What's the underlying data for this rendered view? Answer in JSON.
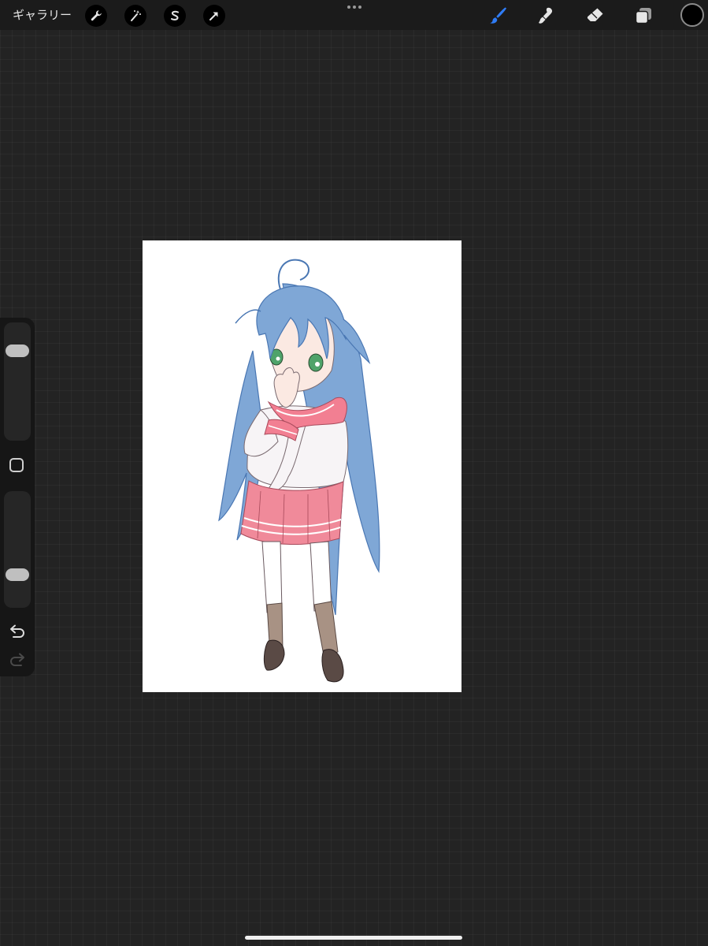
{
  "toolbar": {
    "gallery_label": "ギャラリー",
    "left_tools": [
      "wrench-icon",
      "magic-wand-icon",
      "selection-icon",
      "transform-arrow-icon"
    ],
    "menu_icon": "more-dots-icon",
    "right_tools": [
      "brush-icon",
      "smudge-icon",
      "eraser-icon",
      "layers-icon"
    ],
    "active_tool": "brush",
    "active_color": "#2f7cf6",
    "current_color": "#000000"
  },
  "sidebar": {
    "brush_size_level": 0.8,
    "opacity_level": 0.25,
    "modify_icon": "square-modify-icon",
    "undo_icon": "undo-arrow-icon",
    "redo_icon": "redo-arrow-icon",
    "redo_enabled": false
  },
  "canvas": {
    "background": "#ffffff",
    "artwork": "character-illustration"
  },
  "colors": {
    "hair": "#7fa7d6",
    "hair_line": "#4a77b3",
    "skirt": "#f08a9a",
    "collar": "#f27f92",
    "shirt": "#f7f4f6",
    "socks": "#ffffff",
    "stockings": "#a89284",
    "shoes": "#5a4a45",
    "eyes": "#4fa36a",
    "skin": "#fbe9e2"
  }
}
